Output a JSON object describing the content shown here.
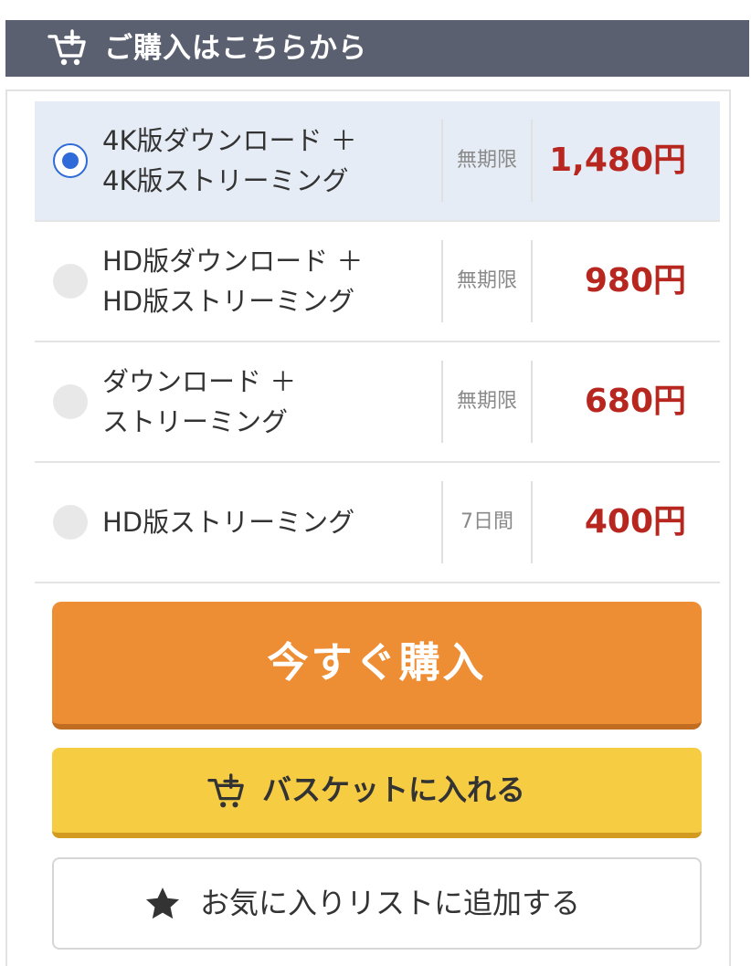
{
  "header": {
    "title": "ご購入はこちらから",
    "icon": "cart-add-icon"
  },
  "options": [
    {
      "line1": "4K版ダウンロード ＋",
      "line2": "4K版ストリーミング",
      "period": "無期限",
      "price": "1,480円",
      "selected": true
    },
    {
      "line1": "HD版ダウンロード ＋",
      "line2": "HD版ストリーミング",
      "period": "無期限",
      "price": "980円",
      "selected": false
    },
    {
      "line1": "ダウンロード ＋",
      "line2": "ストリーミング",
      "period": "無期限",
      "price": "680円",
      "selected": false
    },
    {
      "line1": "HD版ストリーミング",
      "line2": "",
      "period": "7日間",
      "price": "400円",
      "selected": false
    }
  ],
  "buttons": {
    "buy_now": "今すぐ購入",
    "add_to_basket": "バスケットに入れる",
    "add_to_favorites": "お気に入りリストに追加する"
  },
  "colors": {
    "header_bg": "#5a6070",
    "selected_bg": "#e6ecf5",
    "radio_accent": "#2f6bd8",
    "price": "#b8271f",
    "buy_button": "#ee8e34",
    "basket_button": "#f6cc42"
  }
}
